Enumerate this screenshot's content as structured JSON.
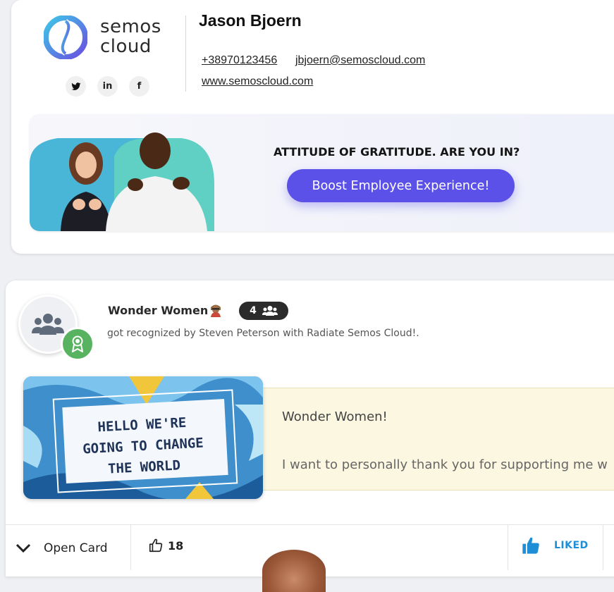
{
  "signature": {
    "brand_line1": "semos",
    "brand_line2": "cloud",
    "name": "Jason Bjoern",
    "phone": "+38970123456",
    "email": "jbjoern@semoscloud.com",
    "website": "www.semoscloud.com",
    "social": [
      {
        "icon": "twitter-icon",
        "glyph": "🐦"
      },
      {
        "icon": "linkedin-icon",
        "glyph": "in"
      },
      {
        "icon": "facebook-icon",
        "glyph": "f"
      }
    ]
  },
  "banner": {
    "headline": "ATTITUDE OF GRATITUDE. ARE YOU IN?",
    "button_label": "Boost Employee Experience!",
    "button_color": "#5b50e8"
  },
  "recognition": {
    "title": "Wonder Women",
    "member_count": "4",
    "subtitle": "got recognized by Steven Peterson with Radiate Semos Cloud!.",
    "card_text_line1": "HELLO WE'RE",
    "card_text_line2": "GOING TO CHANGE",
    "card_text_line3": "THE WORLD",
    "message_greeting": "Wonder Women!",
    "message_body": "I want to personally thank you for supporting me w",
    "badge_color": "#57b35f"
  },
  "footer": {
    "open_card_label": "Open Card",
    "like_count": "18",
    "liked_label": "LIKED",
    "liked_color": "#1e8ed6"
  }
}
